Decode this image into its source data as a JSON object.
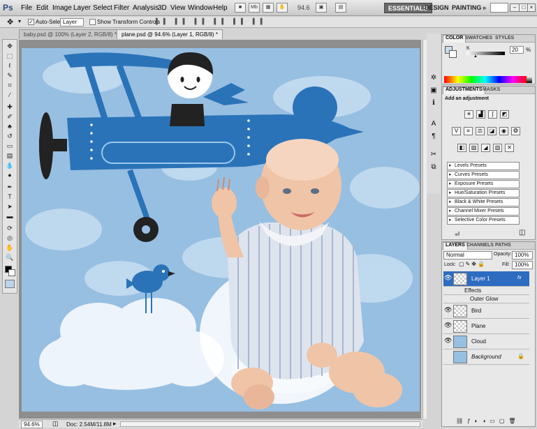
{
  "app": {
    "logo": "Ps",
    "menu": [
      "File",
      "Edit",
      "Image",
      "Layer",
      "Select",
      "Filter",
      "Analysis",
      "3D",
      "View",
      "Window",
      "Help"
    ],
    "zoom_readout": "94.6",
    "workspaces": [
      "ESSENTIALS",
      "DESIGN",
      "PAINTING"
    ],
    "more_label": "»"
  },
  "options": {
    "auto_select_label": "Auto-Select:",
    "auto_select_value": "Layer",
    "show_transform_label": "Show Transform Controls"
  },
  "tabs": [
    {
      "label": "baby.psd @ 100% (Layer 2, RGB/8) *"
    },
    {
      "label": "plane.psd @ 94.6% (Layer 1, RGB/8) *"
    }
  ],
  "status": {
    "zoom": "94.6%",
    "doc": "Doc: 2.54M/11.8M"
  },
  "color_panel": {
    "tabs": [
      "COLOR",
      "SWATCHES",
      "STYLES"
    ],
    "channel_label": "K",
    "value": "20",
    "unit": "%"
  },
  "adjustments_panel": {
    "tabs": [
      "ADJUSTMENTS",
      "MASKS"
    ],
    "heading": "Add an adjustment",
    "presets": [
      "Levels Presets",
      "Curves Presets",
      "Exposure Presets",
      "Hue/Saturation Presets",
      "Black & White Presets",
      "Channel Mixer Presets",
      "Selective Color Presets"
    ]
  },
  "layers_panel": {
    "tabs": [
      "LAYERS",
      "CHANNELS",
      "PATHS"
    ],
    "blend_mode": "Normal",
    "opacity_label": "Opacity:",
    "opacity": "100%",
    "lock_label": "Lock:",
    "fill_label": "Fill:",
    "fill": "100%",
    "layers": [
      {
        "name": "Layer 1",
        "fx": "fx"
      },
      {
        "name": "Effects"
      },
      {
        "name": "Outer Glow"
      },
      {
        "name": "Bird"
      },
      {
        "name": "Plane"
      },
      {
        "name": "Cloud"
      },
      {
        "name": "Background"
      }
    ]
  },
  "colors": {
    "sky": "#97bfe2",
    "plane": "#2a73b8",
    "selection": "#2d6cc0"
  }
}
